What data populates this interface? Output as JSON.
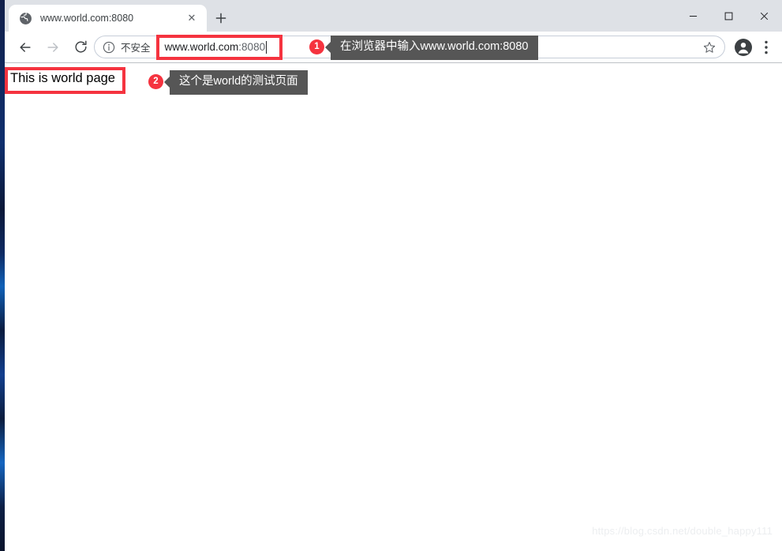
{
  "window": {
    "controls": [
      {
        "name": "minimize",
        "glyph": "—"
      },
      {
        "name": "maximize",
        "glyph": "□"
      },
      {
        "name": "close",
        "glyph": "✕"
      }
    ]
  },
  "tab_strip": {
    "tab": {
      "title": "www.world.com:8080",
      "favicon": "globe-icon",
      "close_glyph": "✕"
    },
    "new_tab_glyph": "+"
  },
  "toolbar": {
    "back_icon": "back-arrow-icon",
    "forward_icon": "forward-arrow-icon",
    "reload_icon": "reload-icon",
    "omnibox": {
      "security_icon": "info-circle-icon",
      "security_label": "不安全",
      "url_host": "www.world.com",
      "url_port": ":8080",
      "bookmark_icon": "star-icon"
    },
    "profile_icon": "account-avatar-icon",
    "menu_icon": "three-dot-menu-icon"
  },
  "page": {
    "heading": "This is world page",
    "watermark": "https://blog.csdn.net/double_happy111"
  },
  "annotations": {
    "accent_color": "#f5333f",
    "callout_bg": "#565656",
    "items": [
      {
        "badge": "1",
        "text": "在浏览器中输入www.world.com:8080"
      },
      {
        "badge": "2",
        "text": "这个是world的测试页面"
      }
    ]
  }
}
